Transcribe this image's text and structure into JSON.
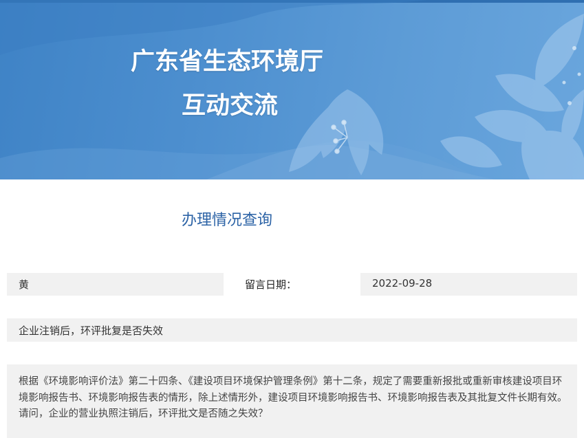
{
  "banner": {
    "title": "广东省生态环境厅",
    "subtitle": "互动交流"
  },
  "section": {
    "title": "办理情况查询"
  },
  "record": {
    "name": "黄",
    "date_label": "留言日期：",
    "date_value": "2022-09-28",
    "subject": "企业注销后，环评批复是否失效",
    "content": "根据《环境影响评价法》第二十四条、《建设项目环境保护管理条例》第十二条，规定了需要重新报批或重新审核建设项目环境影响报告书、环境影响报告表的情形，除上述情形外，建设项目环境影响报告书、环境影响报告表及其批复文件长期有效。请问，企业的营业执照注销后，环评批文是否随之失效？"
  },
  "colors": {
    "banner_blue": "#4d8fcf",
    "title_blue": "#2c63a6",
    "cell_gray": "#f1f1f1"
  }
}
